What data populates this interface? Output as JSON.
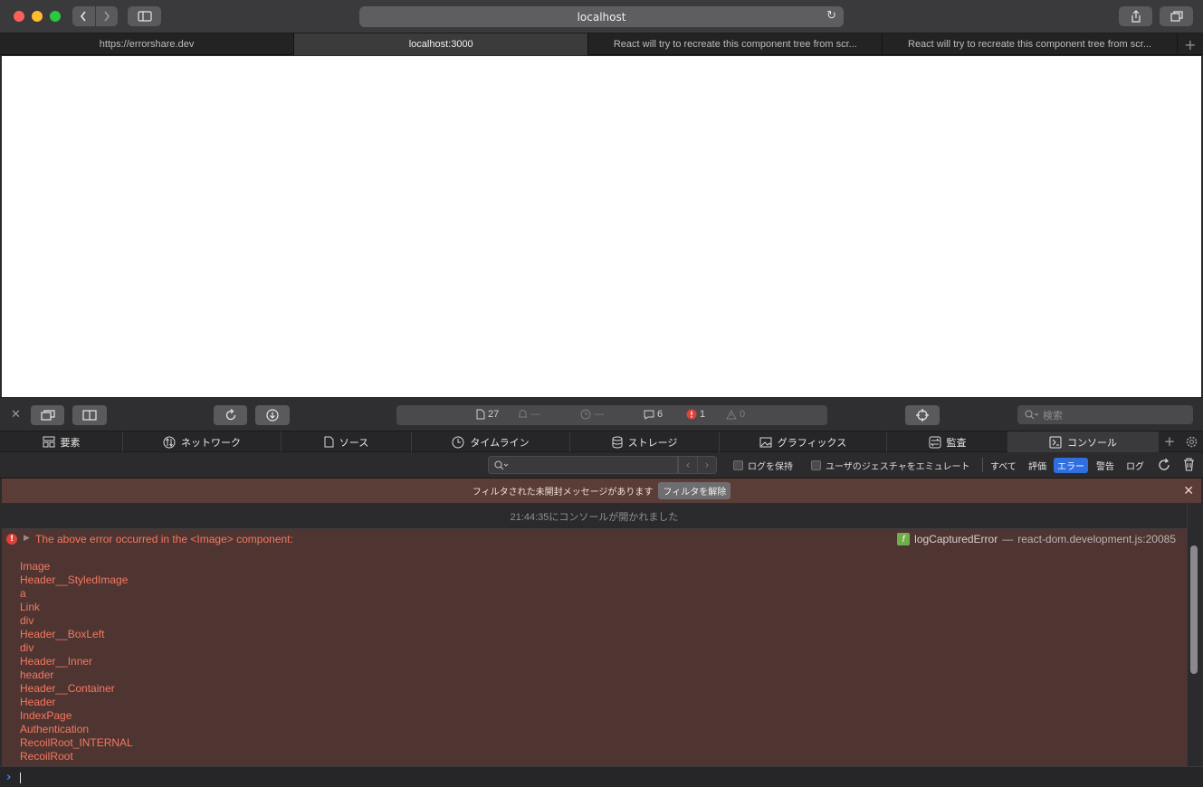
{
  "browser": {
    "url": "localhost",
    "tabs": [
      {
        "title": "https://errorshare.dev",
        "active": false
      },
      {
        "title": "localhost:3000",
        "active": true
      },
      {
        "title": "React will try to recreate this component tree from scr...",
        "active": false
      },
      {
        "title": "React will try to recreate this component tree from scr...",
        "active": false
      }
    ],
    "new_tab_label": "+"
  },
  "devtools": {
    "status": {
      "resources": "27",
      "notifications": "—",
      "time": "—",
      "logs": "6",
      "errors": "1",
      "warnings": "0"
    },
    "search_placeholder": "検索",
    "tabs": [
      {
        "label": "要素",
        "icon": "elements-icon"
      },
      {
        "label": "ネットワーク",
        "icon": "network-icon"
      },
      {
        "label": "ソース",
        "icon": "sources-icon"
      },
      {
        "label": "タイムライン",
        "icon": "timeline-icon"
      },
      {
        "label": "ストレージ",
        "icon": "storage-icon"
      },
      {
        "label": "グラフィックス",
        "icon": "graphics-icon"
      },
      {
        "label": "監査",
        "icon": "audit-icon"
      },
      {
        "label": "コンソール",
        "icon": "console-icon",
        "active": true
      }
    ],
    "filter": {
      "preserve_log": "ログを保持",
      "emulate_gesture": "ユーザのジェスチャをエミュレート",
      "levels": [
        {
          "label": "すべて",
          "active": false
        },
        {
          "label": "評価",
          "active": false
        },
        {
          "label": "エラー",
          "active": true
        },
        {
          "label": "警告",
          "active": false
        },
        {
          "label": "ログ",
          "active": false
        }
      ]
    },
    "banner": {
      "message": "フィルタされた未開封メッセージがあります",
      "button": "フィルタを解除"
    },
    "console": {
      "opened_at": "21:44:35にコンソールが開かれました",
      "error": {
        "message": "The above error occurred in the <Image> component:",
        "function": "logCapturedError",
        "separator": "—",
        "source": "react-dom.development.js:20085",
        "stack": [
          "Image",
          "Header__StyledImage",
          "a",
          "Link",
          "div",
          "Header__BoxLeft",
          "div",
          "Header__Inner",
          "header",
          "Header__Container",
          "Header",
          "IndexPage",
          "Authentication",
          "RecoilRoot_INTERNAL",
          "RecoilRoot"
        ]
      }
    }
  },
  "colors": {
    "error_text": "#f6775f",
    "error_bg": "#4e3532",
    "active_filter": "#2f6fe0"
  }
}
